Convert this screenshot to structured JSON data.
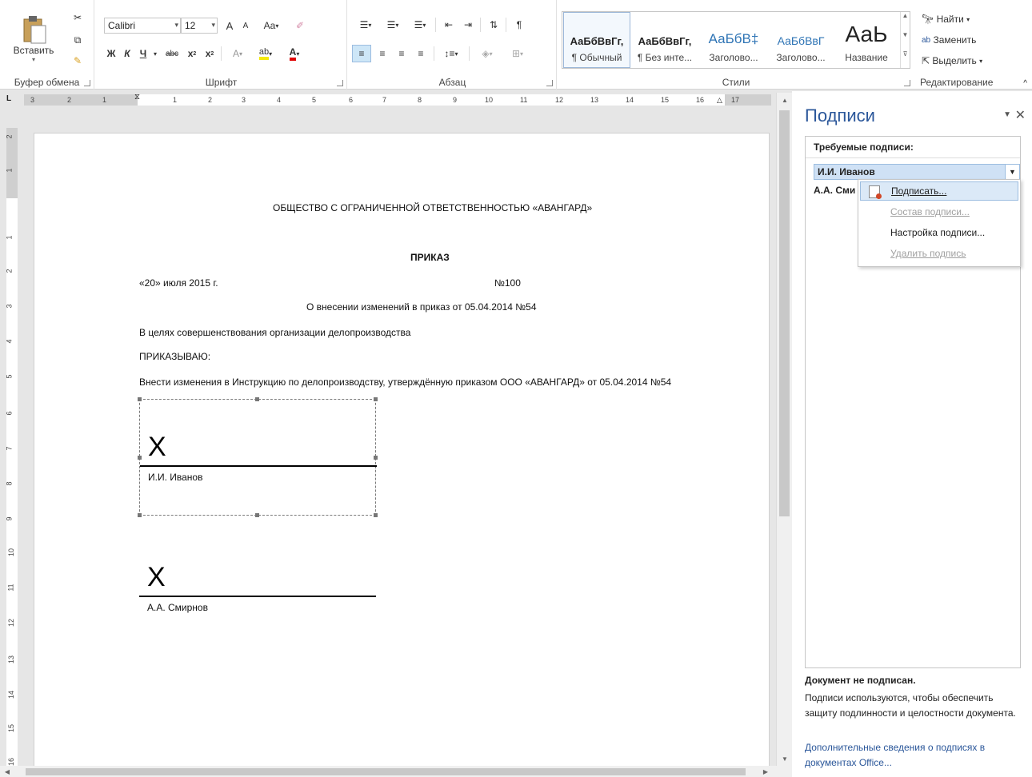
{
  "ribbon": {
    "clipboard": {
      "paste": "Вставить",
      "label": "Буфер обмена"
    },
    "font": {
      "name": "Calibri",
      "size": "12",
      "label": "Шрифт",
      "grow": "A",
      "shrink": "A",
      "case": "Aa",
      "bold": "Ж",
      "italic": "К",
      "underline": "Ч",
      "strike": "abc",
      "sub": "x",
      "sup": "x",
      "effects": "A",
      "highlight": "ab",
      "color": "A"
    },
    "paragraph": {
      "label": "Абзац",
      "pilcrow": "¶"
    },
    "styles": {
      "label": "Стили",
      "items": [
        {
          "preview": "АаБбВвГг,",
          "name": "¶ Обычный"
        },
        {
          "preview": "АаБбВвГг,",
          "name": "¶ Без инте..."
        },
        {
          "preview": "АаБбВ‡",
          "name": "Заголово..."
        },
        {
          "preview": "АаБбВвГ",
          "name": "Заголово..."
        },
        {
          "preview": "АаЬ",
          "name": "Название"
        }
      ]
    },
    "editing": {
      "label": "Редактирование",
      "find": "Найти",
      "replace": "Заменить",
      "select": "Выделить"
    }
  },
  "ruler": {
    "h_ticks": [
      "3",
      "2",
      "1",
      "1",
      "2",
      "3",
      "4",
      "5",
      "6",
      "7",
      "8",
      "9",
      "10",
      "11",
      "12",
      "13",
      "14",
      "15",
      "16",
      "17"
    ],
    "v_ticks": [
      "2",
      "1",
      "1",
      "2",
      "3",
      "4",
      "5",
      "6",
      "7",
      "8",
      "9",
      "10",
      "11",
      "12",
      "13",
      "14",
      "15",
      "16"
    ]
  },
  "document": {
    "org": "ОБЩЕСТВО С ОГРАНИЧЕННОЙ ОТВЕТСТВЕННОСТЬЮ «АВАНГАРД»",
    "title": "ПРИКАЗ",
    "date": "«20» июля 2015 г.",
    "number": "№100",
    "subject": "О внесении изменений в приказ от 05.04.2014 №54",
    "purpose": "В целях совершенствования организации делопроизводства",
    "order": "ПРИКАЗЫВАЮ:",
    "body": "Внести изменения в Инструкцию по делопроизводству, утверждённую приказом ООО «АВАНГАРД» от 05.04.2014 №54",
    "sig1": {
      "x": "X",
      "name": "И.И. Иванов"
    },
    "sig2": {
      "x": "X",
      "name": "А.А. Смирнов"
    }
  },
  "pane": {
    "title": "Подписи",
    "required_label": "Требуемые подписи:",
    "selected_signer": "И.И. Иванов",
    "second_signer": "А.А. Сми",
    "context_menu": [
      {
        "label": "Подписать...",
        "enabled": true
      },
      {
        "label": "Состав подписи...",
        "enabled": false
      },
      {
        "label": "Настройка подписи...",
        "enabled": true
      },
      {
        "label": "Удалить подпись",
        "enabled": false
      }
    ],
    "status": "Документ не подписан.",
    "description": "Подписи используются, чтобы обеспечить защиту подлинности и целостности документа.",
    "link": "Дополнительные сведения о подписях в документах Office..."
  },
  "colors": {
    "accent": "#2b579a",
    "selection": "#cfe1f5",
    "red_mark": "#d24726"
  }
}
